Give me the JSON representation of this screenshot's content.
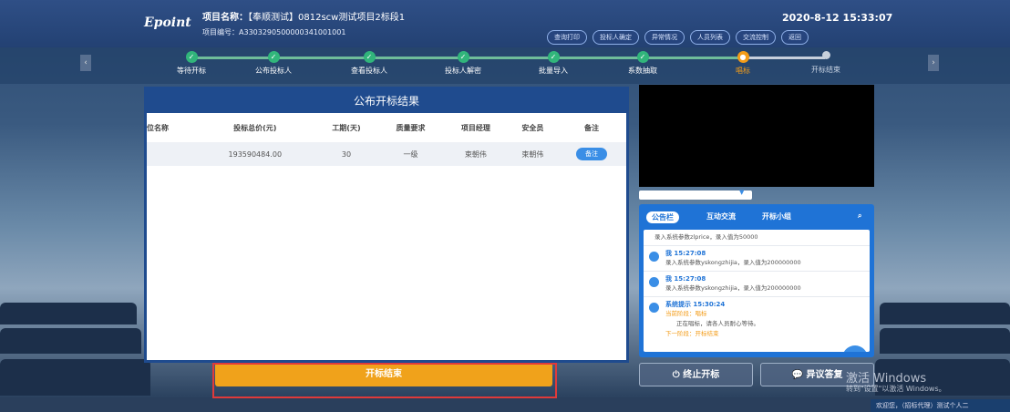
{
  "header": {
    "logo": "Epoint",
    "project_name_label": "项目名称：",
    "project_name": "【奉顺测试】0812scw测试项目2标段1",
    "project_code_label": "项目编号：",
    "project_code": "A3303290500000341001001",
    "buttons": [
      "查询打印",
      "投标人确定",
      "异常情况",
      "人员列表",
      "交流控制",
      "返回"
    ],
    "datetime": "2020-8-12  15:33:07"
  },
  "steps": [
    {
      "label": "等待开标",
      "state": "done"
    },
    {
      "label": "公布投标人",
      "state": "done"
    },
    {
      "label": "查看投标人",
      "state": "done"
    },
    {
      "label": "投标人解密",
      "state": "done"
    },
    {
      "label": "批量导入",
      "state": "done"
    },
    {
      "label": "系数抽取",
      "state": "done"
    },
    {
      "label": "唱标",
      "state": "current"
    },
    {
      "label": "开标结束",
      "state": "pending"
    }
  ],
  "results": {
    "title": "公布开标结果",
    "columns": [
      "位名称",
      "投标总价(元)",
      "工期(天)",
      "质量要求",
      "项目经理",
      "安全员",
      "备注"
    ],
    "rows": [
      {
        "name": "",
        "price": "193590484.00",
        "period": "30",
        "quality": "一级",
        "manager": "束朝伟",
        "safety": "束朝伟",
        "note_button": "备注"
      }
    ]
  },
  "chat": {
    "tabs": [
      "公告栏",
      "互动交流",
      "开标小组"
    ],
    "messages": [
      {
        "who": "",
        "text": "录入系统参数zlprice，录入值为50000"
      },
      {
        "who": "我 15:27:08",
        "text": "录入系统参数yskongzhijia，录入值为200000000"
      },
      {
        "who": "我 15:27:08",
        "text": "录入系统参数yskongzhijia，录入值为200000000"
      },
      {
        "who": "系统提示 15:30:24",
        "line1": "当前阶段：唱标",
        "line2": "正在唱标，请各人员耐心等待。",
        "line3": "下一阶段：开标结束"
      }
    ],
    "private_button": "私聊"
  },
  "actions": {
    "end_label": "开标结束",
    "stop_label": "⏻ 终止开标",
    "objection_label": "异议答复"
  },
  "watermark": {
    "line1": "激活 Windows",
    "line2": "转到\"设置\"以激活 Windows。"
  },
  "bottom_strip": "欢迎您，（招标代理）测试个人二"
}
